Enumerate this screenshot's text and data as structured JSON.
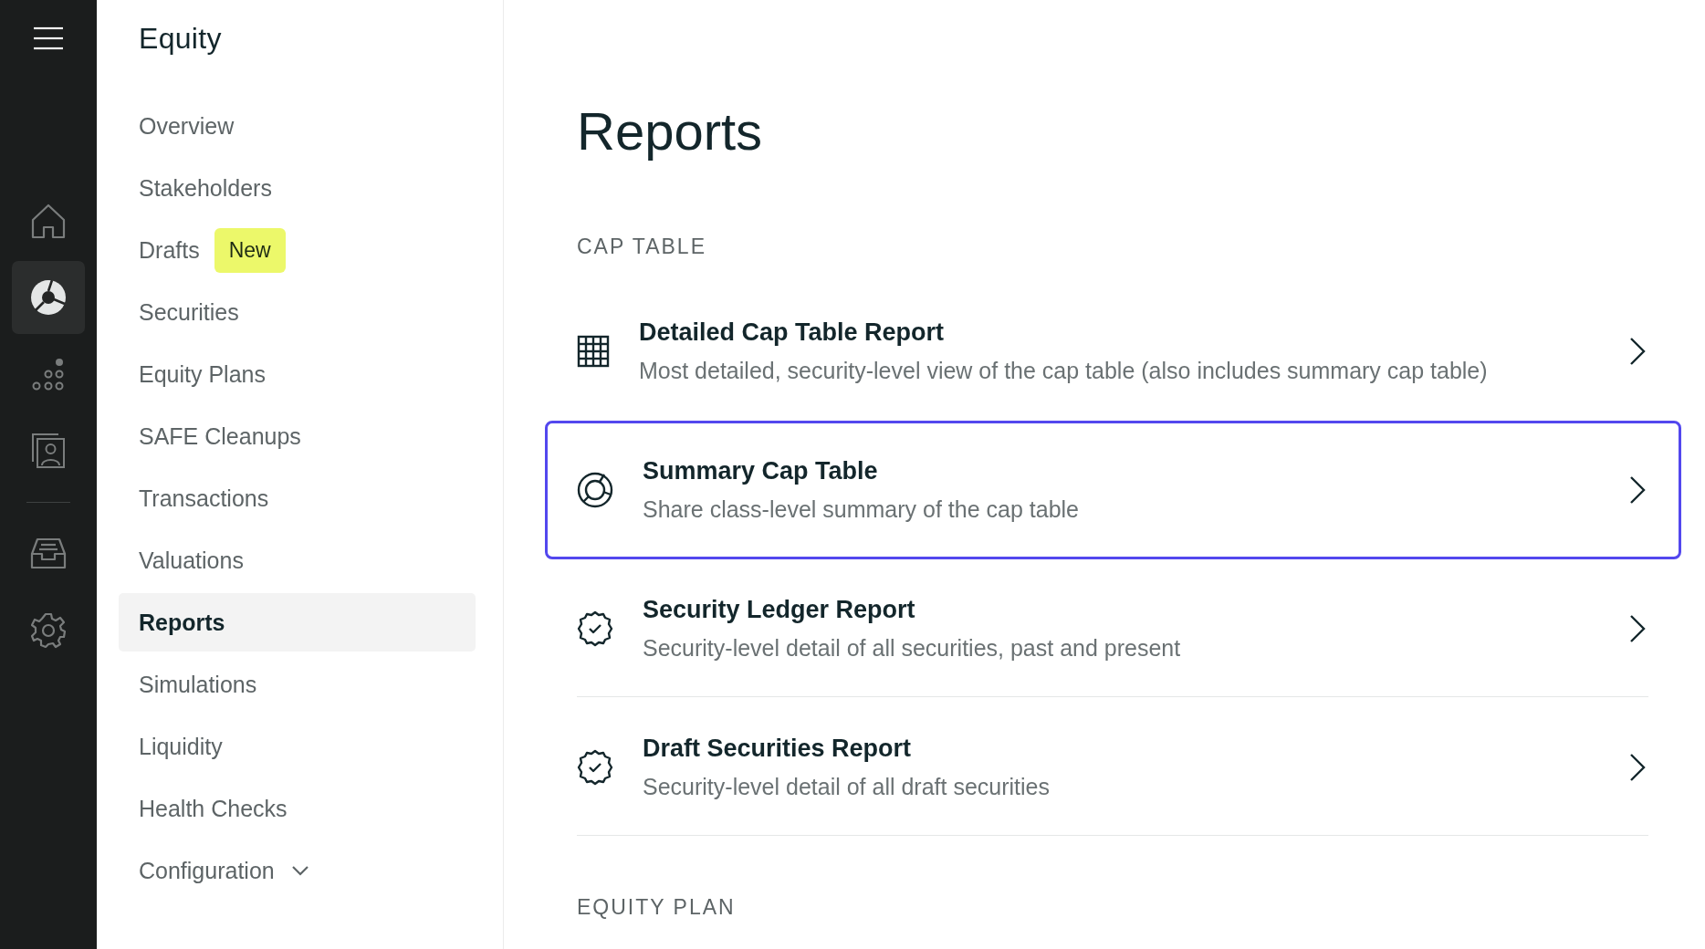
{
  "rail": {
    "items": [
      {
        "kind": "home",
        "selected": false
      },
      {
        "kind": "equity",
        "selected": true
      },
      {
        "kind": "dots",
        "selected": false
      },
      {
        "kind": "contacts",
        "selected": false
      },
      {
        "kind": "divider"
      },
      {
        "kind": "inbox",
        "selected": false
      },
      {
        "kind": "settings",
        "selected": false
      }
    ]
  },
  "sidebar": {
    "title": "Equity",
    "items": [
      {
        "label": "Overview",
        "selected": false
      },
      {
        "label": "Stakeholders",
        "selected": false
      },
      {
        "label": "Drafts",
        "selected": false,
        "badge": "New"
      },
      {
        "label": "Securities",
        "selected": false
      },
      {
        "label": "Equity Plans",
        "selected": false
      },
      {
        "label": "SAFE Cleanups",
        "selected": false
      },
      {
        "label": "Transactions",
        "selected": false
      },
      {
        "label": "Valuations",
        "selected": false
      },
      {
        "label": "Reports",
        "selected": true
      },
      {
        "label": "Simulations",
        "selected": false
      },
      {
        "label": "Liquidity",
        "selected": false
      },
      {
        "label": "Health Checks",
        "selected": false
      },
      {
        "label": "Configuration",
        "selected": false,
        "expanded": false
      }
    ]
  },
  "main": {
    "title": "Reports",
    "sections": [
      {
        "heading": "CAP TABLE",
        "reports": [
          {
            "kind": "grid",
            "title": "Detailed Cap Table Report",
            "description": "Most detailed, security-level view of the cap table (also includes summary cap table)",
            "selected": false
          },
          {
            "kind": "ring",
            "title": "Summary Cap Table",
            "description": "Share class-level summary of the cap table",
            "selected": true
          },
          {
            "kind": "badge",
            "title": "Security Ledger Report",
            "description": "Security-level detail of all securities, past and present",
            "selected": false
          },
          {
            "kind": "badge",
            "title": "Draft Securities Report",
            "description": "Security-level detail of all draft securities",
            "selected": false
          }
        ]
      },
      {
        "heading": "EQUITY PLAN"
      }
    ]
  }
}
